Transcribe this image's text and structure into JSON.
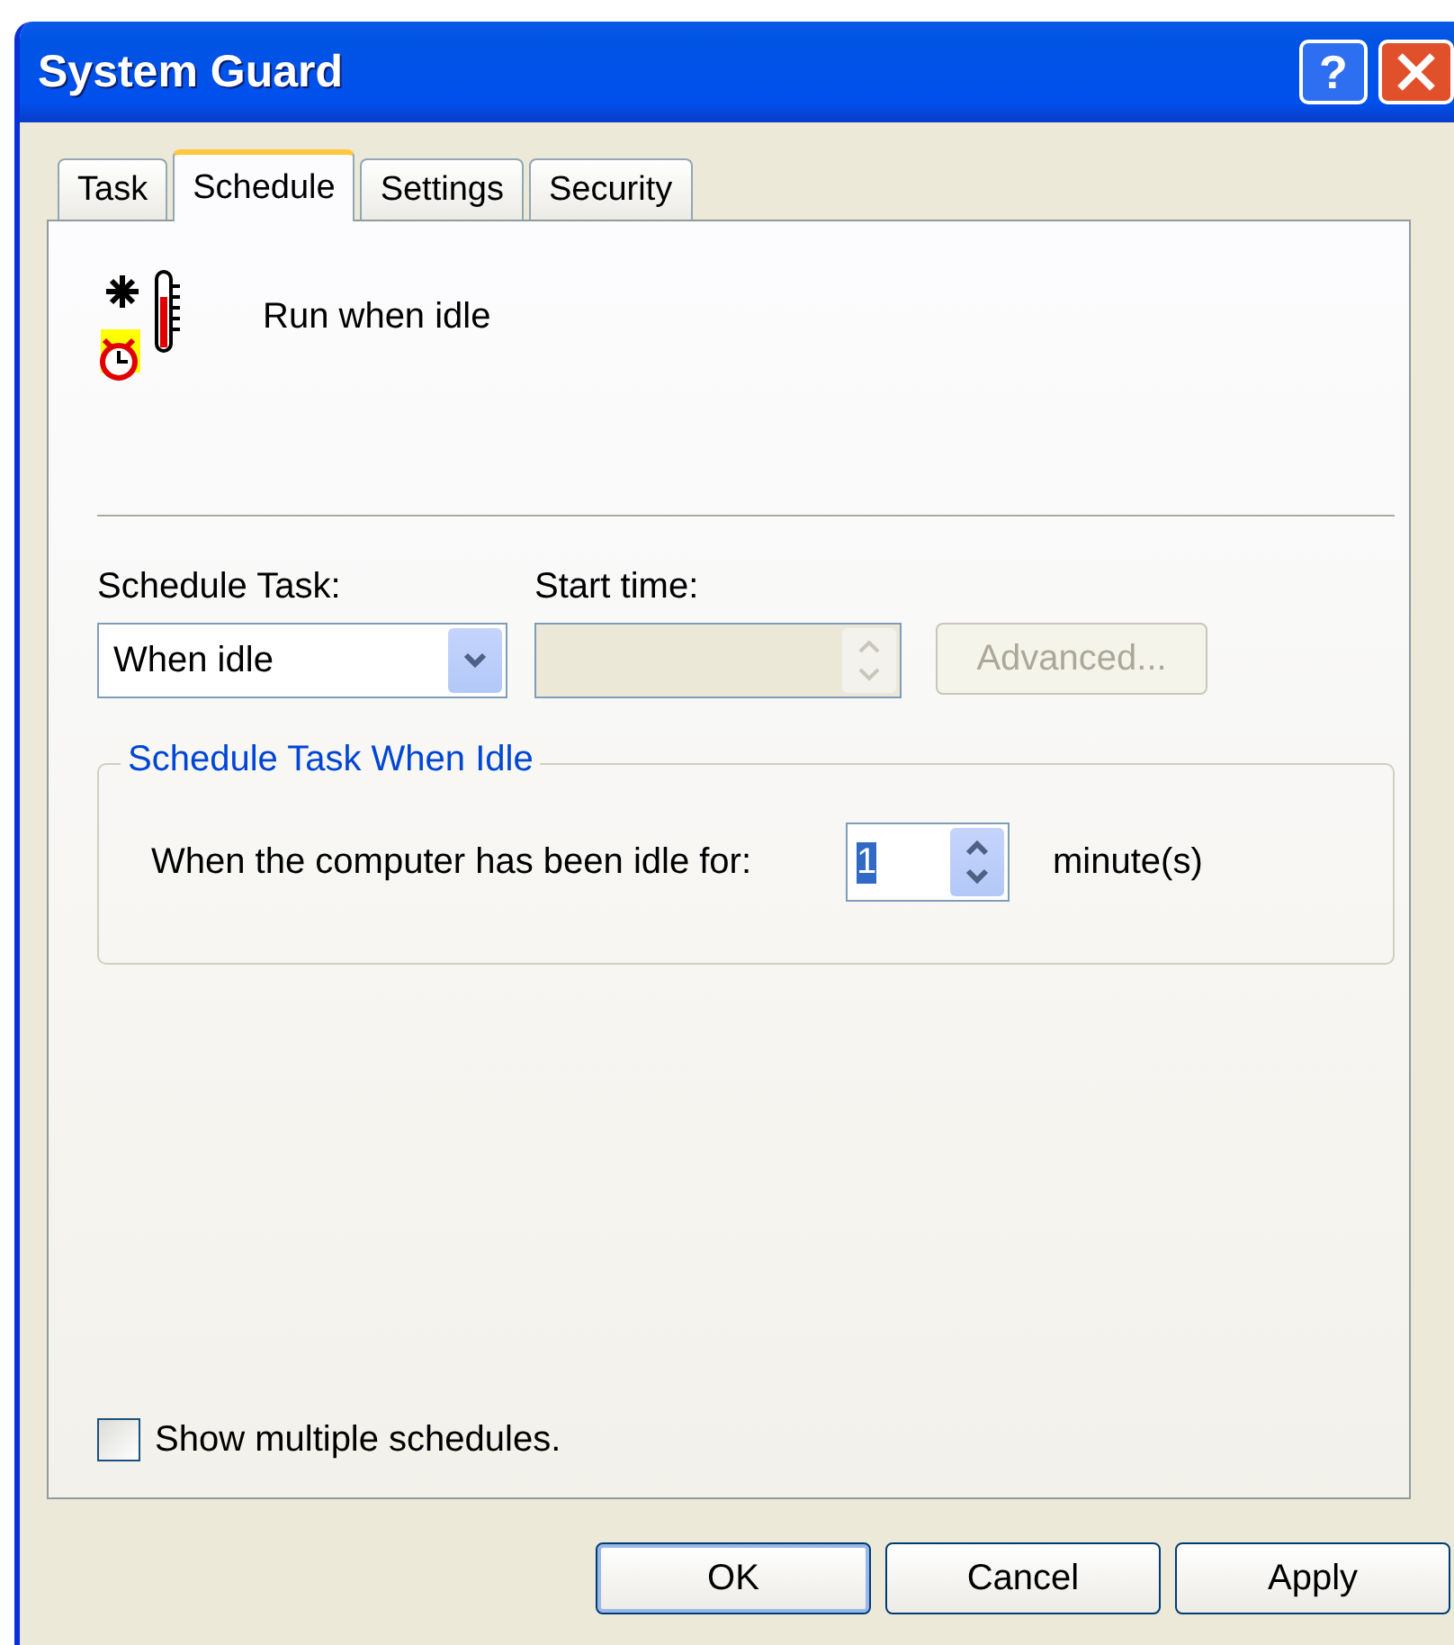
{
  "window": {
    "title": "System Guard",
    "help": "?"
  },
  "tabs": [
    {
      "label": "Task",
      "selected": false
    },
    {
      "label": "Schedule",
      "selected": true
    },
    {
      "label": "Settings",
      "selected": false
    },
    {
      "label": "Security",
      "selected": false
    }
  ],
  "header": {
    "text": "Run when idle"
  },
  "schedule_task": {
    "label": "Schedule Task:",
    "value": "When idle"
  },
  "start_time": {
    "label": "Start time:",
    "disabled": true
  },
  "advanced_button": {
    "label": "Advanced...",
    "disabled": true
  },
  "idle_group": {
    "legend": "Schedule Task When Idle",
    "label": "When the computer has been idle for:",
    "value": "1",
    "highlighted": true,
    "unit": "minute(s)"
  },
  "show_multiple": {
    "label": "Show multiple schedules.",
    "checked": false
  },
  "buttons": [
    {
      "label": "OK",
      "default": true
    },
    {
      "label": "Cancel",
      "default": false
    },
    {
      "label": "Apply",
      "default": false
    }
  ]
}
